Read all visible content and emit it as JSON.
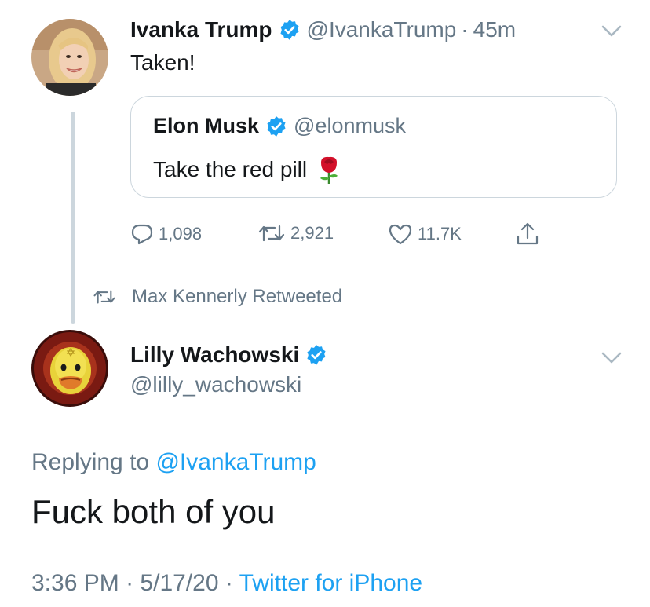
{
  "tweet1": {
    "author_name": "Ivanka Trump",
    "handle": "@IvankaTrump",
    "separator": "·",
    "time": "45m",
    "text": "Taken!",
    "quoted": {
      "author_name": "Elon Musk",
      "handle": "@elonmusk",
      "text": "Take the red pill",
      "emoji": "rose"
    },
    "actions": {
      "replies": "1,098",
      "retweets": "2,921",
      "likes": "11.7K"
    }
  },
  "retweet_notice": {
    "text": "Max Kennerly Retweeted"
  },
  "tweet2": {
    "author_name": "Lilly Wachowski",
    "handle": "@lilly_wachowski",
    "replying_prefix": "Replying to",
    "replying_handle": "@IvankaTrump",
    "text": "Fuck both of you",
    "time": "3:36 PM",
    "separator": "·",
    "date": "5/17/20",
    "source": "Twitter for iPhone"
  },
  "colors": {
    "text": "#14171a",
    "secondary": "#657786",
    "accent": "#1da1f2",
    "border": "#ccd6dd",
    "heart": "#657786"
  }
}
